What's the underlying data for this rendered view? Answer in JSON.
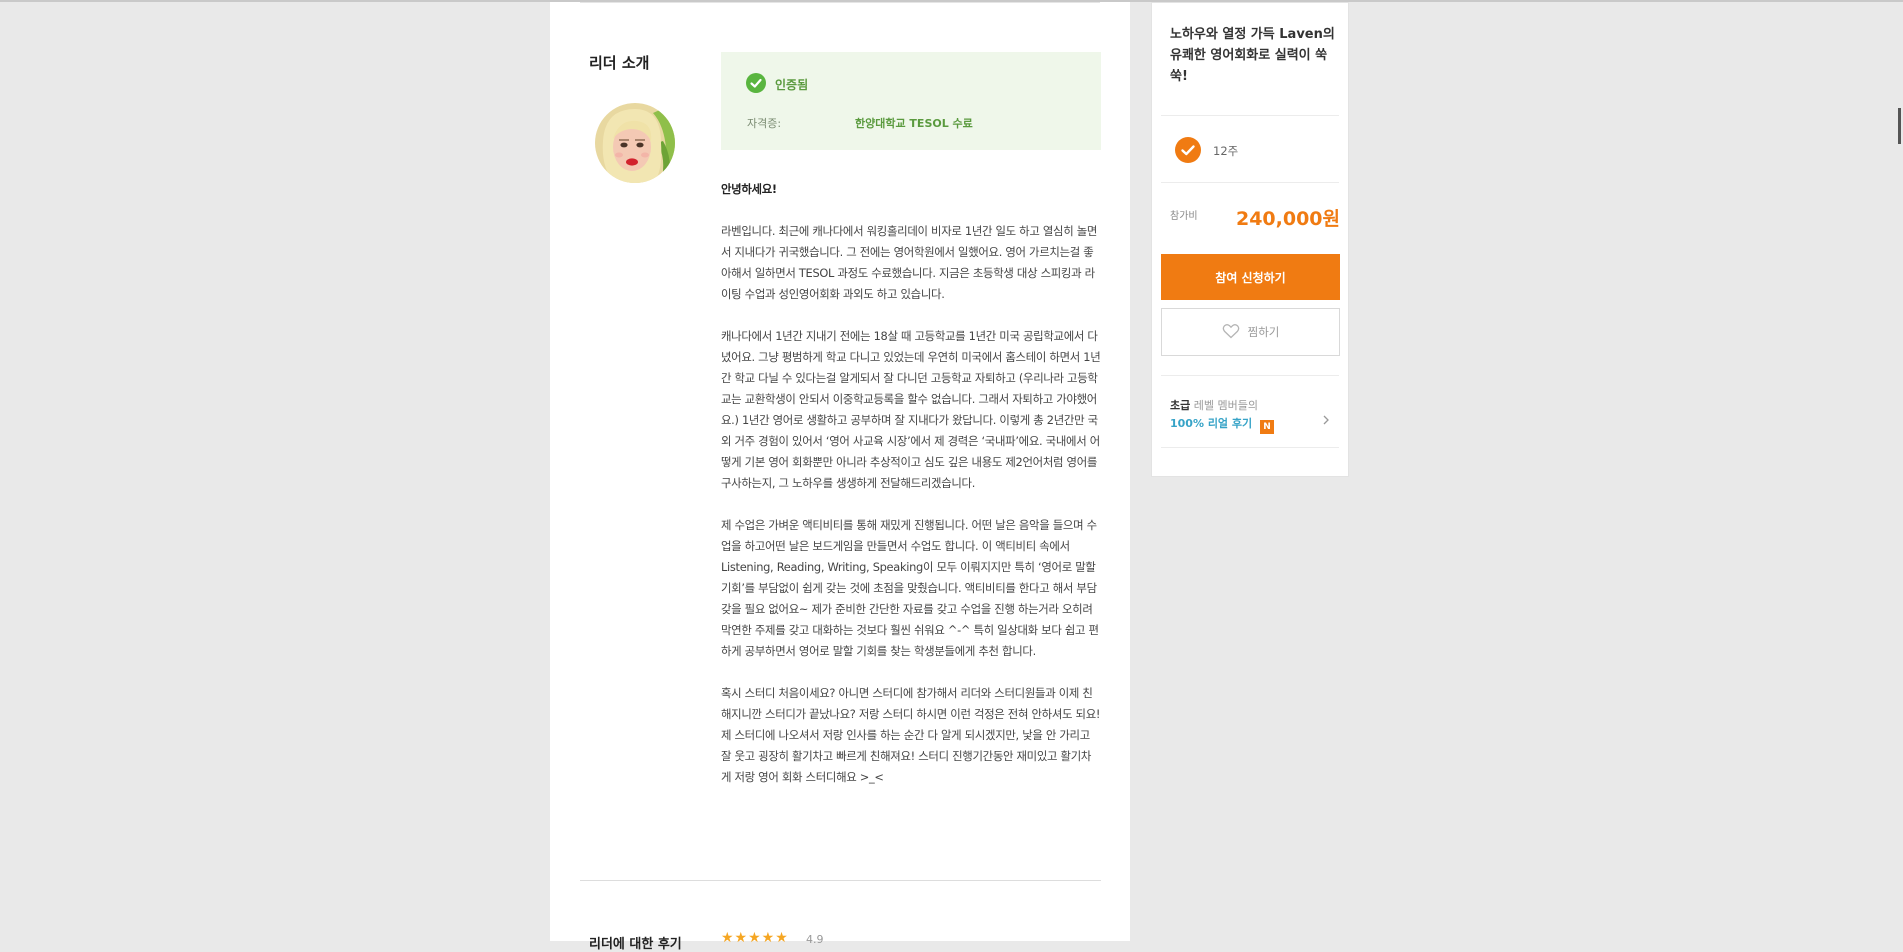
{
  "leader": {
    "heading": "리더 소개",
    "certification": {
      "status": "인증됨",
      "label": "자격증:",
      "value": "한양대학교 TESOL 수료"
    },
    "bio": {
      "greeting": "안녕하세요!",
      "paragraphs": [
        "라벤입니다. 최근에 캐나다에서 워킹홀리데이 비자로 1년간 일도 하고 열심히 놀면서 지내다가 귀국했습니다. 그 전에는 영어학원에서 일했어요. 영어 가르치는걸 좋아해서 일하면서 TESOL 과정도 수료했습니다. 지금은 초등학생 대상 스피킹과 라이팅 수업과 성인영어회화 과외도 하고 있습니다.",
        "캐나다에서 1년간 지내기 전에는 18살 때 고등학교를 1년간 미국 공립학교에서 다녔어요. 그냥 평범하게 학교 다니고 있었는데 우연히 미국에서 홈스테이 하면서 1년간 학교 다닐 수 있다는걸 알게되서 잘 다니던 고등학교 자퇴하고 (우리나라 고등학교는 교환학생이 안되서 이중학교등록을 할수 없습니다. 그래서 자퇴하고 가야했어요.) 1년간 영어로 생활하고 공부하며 잘 지내다가 왔답니다. 이렇게 총 2년간만 국외 거주 경험이 있어서 ‘영어 사교육 시장’에서 제 경력은 ‘국내파’에요. 국내에서 어떻게 기본 영어 회화뿐만 아니라 추상적이고 심도 깊은 내용도 제2언어처럼 영어를 구사하는지, 그 노하우를 생생하게 전달해드리겠습니다.",
        "제 수업은 가벼운 액티비티를 통해 재밌게 진행됩니다. 어떤 날은 음악을 들으며 수업을 하고어떤 날은 보드게임을 만들면서 수업도 합니다. 이 액티비티 속에서 Listening, Reading, Writing, Speaking이 모두 이뤄지지만 특히 ‘영어로 말할 기회’를 부담없이 쉽게 갖는 것에 초점을 맞췄습니다. 액티비티를 한다고 해서 부담 갖을 필요 없어요~ 제가 준비한 간단한 자료를 갖고 수업을 진행 하는거라 오히려 막연한 주제를 갖고 대화하는 것보다 훨씬 쉬워요 ^-^ 특히 일상대화 보다 쉽고 편하게 공부하면서 영어로 말할 기회를 찾는 학생분들에게 추천 합니다.",
        "혹시 스터디 처음이세요? 아니면 스터디에 참가해서 리더와 스터디원들과 이제 친해지니깐 스터디가 끝났나요? 저랑 스터디 하시면 이런 걱정은 전혀 안하셔도 되요! 제 스터디에 나오셔서 저랑 인사를 하는 순간 다 알게 되시겠지만, 낯을 안 가리고 잘 웃고 굉장히 활기차고 빠르게 친해져요! 스터디 진행기간동안 재미있고 활기차게 저랑 영어 회화 스터디해요 >_<"
      ]
    }
  },
  "reviews_section": {
    "heading": "리더에 대한 후기",
    "stars": "★★★★★",
    "rating": "4.9"
  },
  "sidebar": {
    "title": "노하우와 열정 가득 Laven의 유쾌한 영어회화로 실력이 쑥쑥!",
    "duration": "12주",
    "fee_label": "참가비",
    "fee_value": "240,000원",
    "apply_label": "참여 신청하기",
    "wishlist_label": "찜하기",
    "review_link": {
      "level": "초급",
      "level_suffix": "레벨 멤버들의",
      "review_text": "100% 리얼 후기",
      "badge": "N"
    }
  },
  "colors": {
    "accent": "#f07b12",
    "cert_green": "#59b53f",
    "cert_bg": "#eff7ea",
    "link_blue": "#36a3c7",
    "background": "#e9e9e9"
  }
}
